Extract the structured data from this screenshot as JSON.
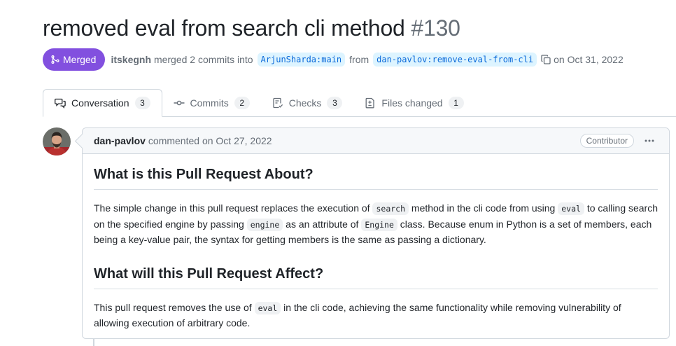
{
  "pr": {
    "title": "removed eval from search cli method",
    "number": "#130",
    "state": "Merged",
    "state_color": "#8250df",
    "author": "itskegnh",
    "merged_text": "merged 2 commits into",
    "base_branch": "ArjunSharda:main",
    "from_text": "from",
    "head_branch": "dan-pavlov:remove-eval-from-cli",
    "date_text": "on Oct 31, 2022"
  },
  "tabs": [
    {
      "label": "Conversation",
      "count": "3",
      "icon": "comment-discussion-icon",
      "active": true
    },
    {
      "label": "Commits",
      "count": "2",
      "icon": "git-commit-icon"
    },
    {
      "label": "Checks",
      "count": "3",
      "icon": "checklist-icon"
    },
    {
      "label": "Files changed",
      "count": "1",
      "icon": "file-diff-icon"
    }
  ],
  "comment": {
    "author": "dan-pavlov",
    "meta": "commented on Oct 27, 2022",
    "role": "Contributor",
    "heading1": "What is this Pull Request About?",
    "p1": {
      "t1": "The simple change in this pull request replaces the execution of",
      "c1": "search",
      "t2": "method in the cli code from using",
      "c2": "eval",
      "t3": "to calling search on the specified engine by passing",
      "c3": "engine",
      "t4": "as an attribute of",
      "c4": "Engine",
      "t5": "class. Because enum in Python is a set of members, each being a key-value pair, the syntax for getting members is the same as passing a dictionary."
    },
    "heading2": "What will this Pull Request Affect?",
    "p2": {
      "t1": "This pull request removes the use of",
      "c1": "eval",
      "t2": "in the cli code, achieving the same functionality while removing vulnerability of allowing execution of arbitrary code."
    }
  }
}
